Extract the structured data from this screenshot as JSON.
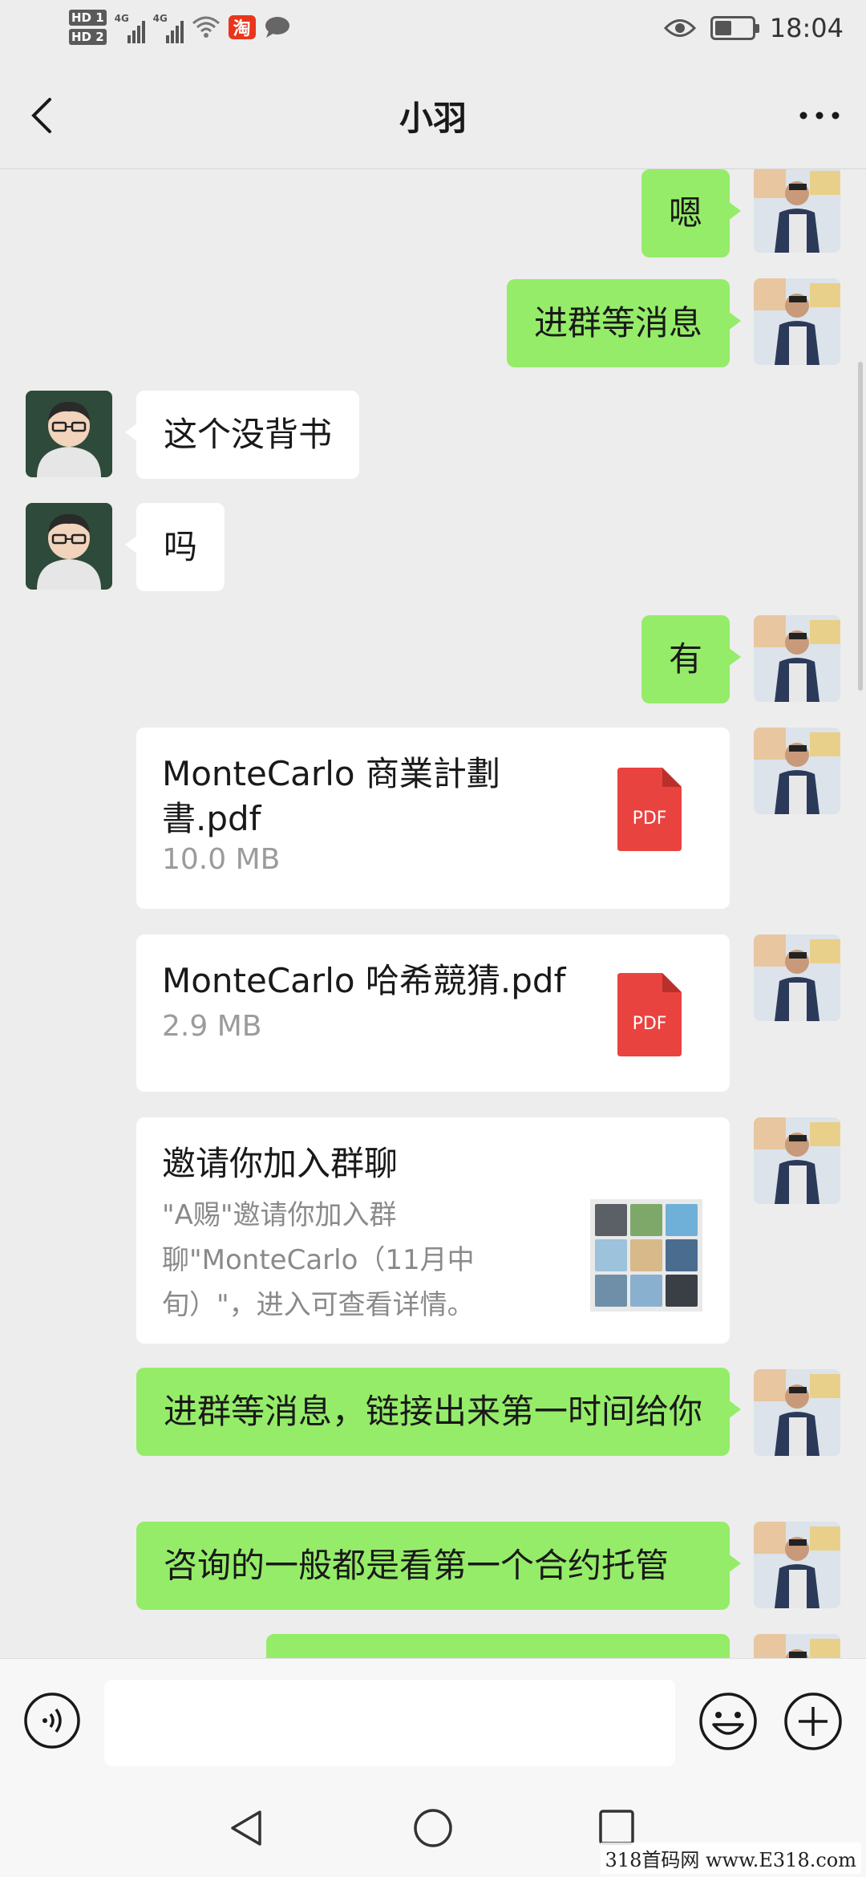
{
  "status_bar": {
    "hd1": "HD 1",
    "hd2": "HD 2",
    "net1": "4G",
    "net2": "4G",
    "taobao_glyph": "淘",
    "time": "18:04",
    "battery_level": 0.45
  },
  "header": {
    "title": "小羽"
  },
  "messages": [
    {
      "from": "me",
      "type": "text",
      "text": "嗯"
    },
    {
      "from": "me",
      "type": "text",
      "text": "进群等消息"
    },
    {
      "from": "other",
      "type": "text",
      "text": "这个没背书"
    },
    {
      "from": "other",
      "type": "text",
      "text": "吗"
    },
    {
      "from": "me",
      "type": "text",
      "text": "有"
    },
    {
      "from": "me",
      "type": "file",
      "name": "MonteCarlo 商業計劃書.pdf",
      "size": "10.0 MB",
      "icon": "pdf-icon",
      "icon_label": "PDF"
    },
    {
      "from": "me",
      "type": "file",
      "name": "MonteCarlo  哈希競猜.pdf",
      "size": "2.9 MB",
      "icon": "pdf-icon",
      "icon_label": "PDF"
    },
    {
      "from": "me",
      "type": "invite",
      "title": "邀请你加入群聊",
      "desc": "\"A赐\"邀请你加入群聊\"MonteCarlo（11月中旬）\"，进入可查看详情。"
    },
    {
      "from": "me",
      "type": "text",
      "text": "进群等消息，链接出来第一时间给你"
    },
    {
      "from": "me",
      "type": "text",
      "text": "咨询的一般都是看第一个合约托管"
    }
  ],
  "input_bar": {
    "placeholder": "",
    "value": ""
  },
  "watermark": "318首码网  www.E318.com",
  "colors": {
    "background": "#ededed",
    "my_bubble": "#95ec69",
    "their_bubble": "#ffffff",
    "pdf_red": "#e94340",
    "taobao": "#e8361c"
  }
}
